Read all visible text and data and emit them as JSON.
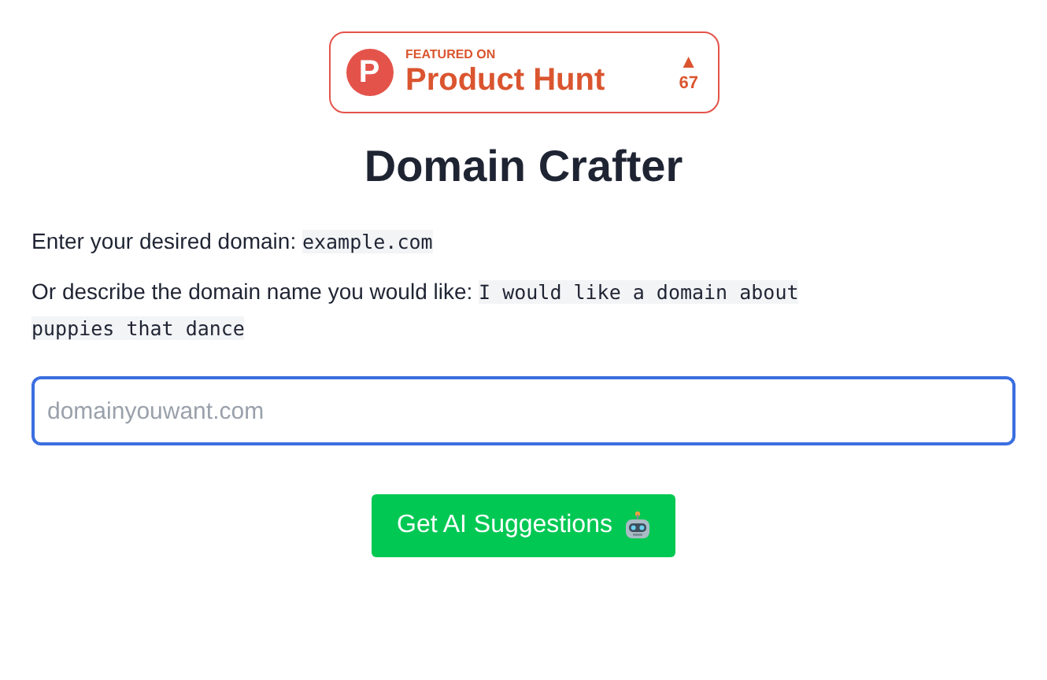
{
  "badge": {
    "logo_letter": "P",
    "caption": "FEATURED ON",
    "name": "Product Hunt",
    "arrow": "▲",
    "votes": "67"
  },
  "title": "Domain Crafter",
  "instructions": [
    {
      "label": "Enter your desired domain:",
      "example_lines": [
        "example.com"
      ]
    },
    {
      "label": "Or describe the domain name you would like:",
      "example_lines": [
        "I would like a domain about",
        "puppies that dance"
      ]
    }
  ],
  "domain_field": {
    "placeholder": "domainyouwant.com",
    "focused": true
  },
  "submit_button": {
    "label": "Get AI Suggestions"
  }
}
